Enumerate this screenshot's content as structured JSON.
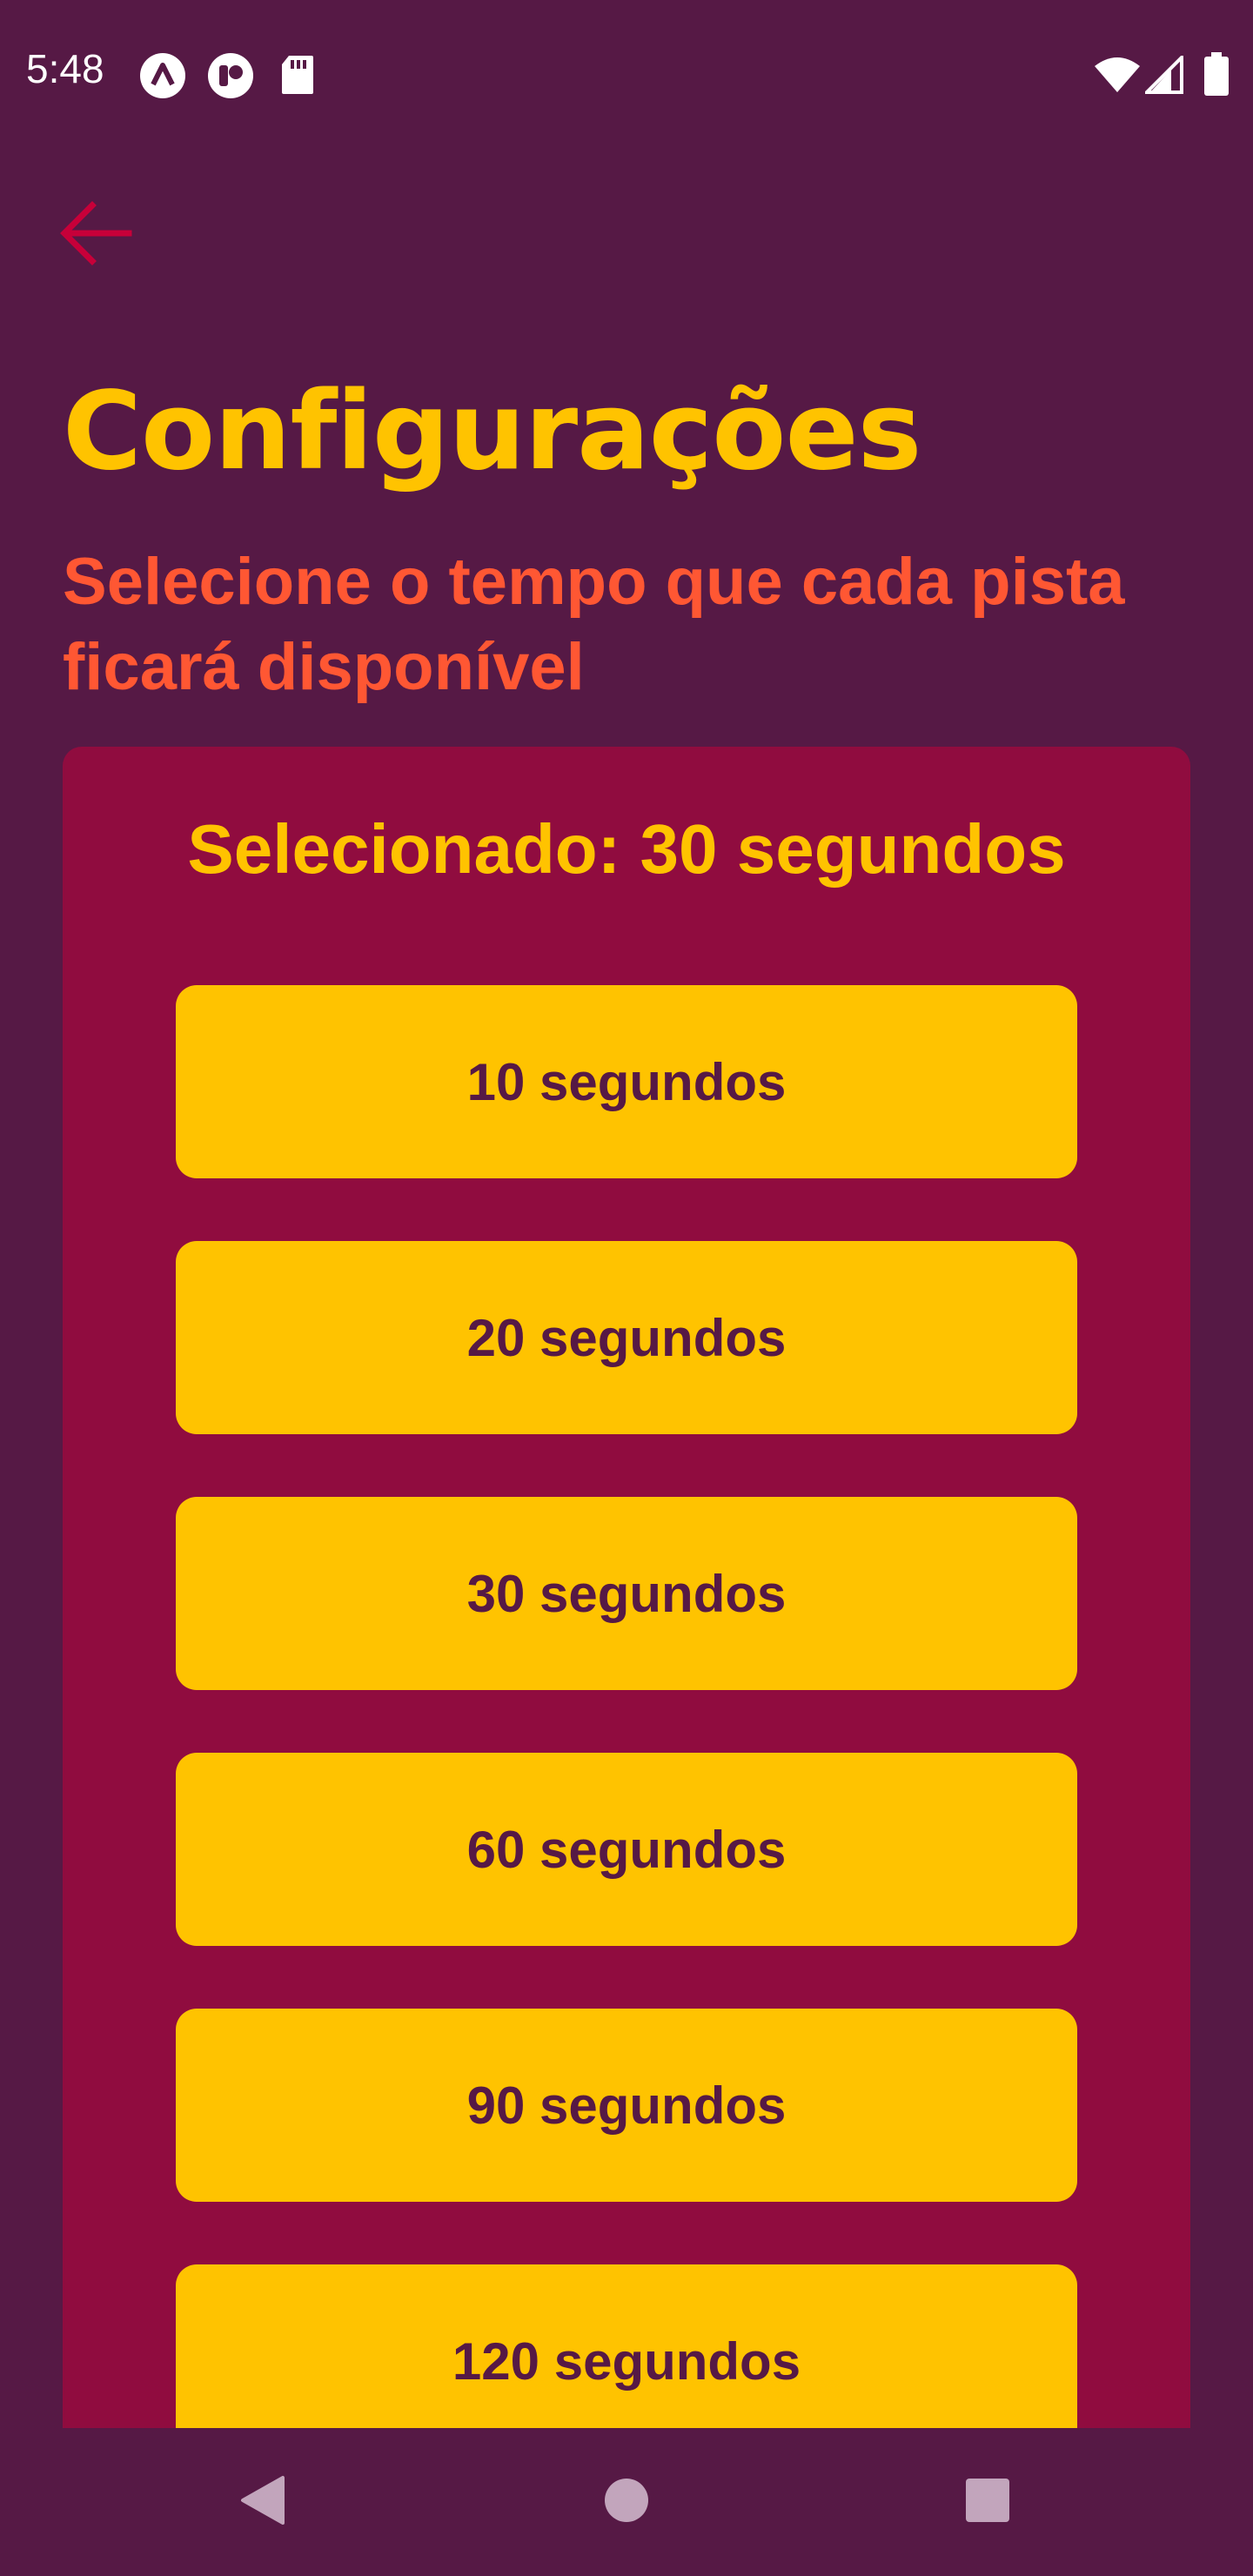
{
  "status_bar": {
    "time": "5:48",
    "left_icons": [
      "a-logo-icon",
      "circle-app-icon",
      "sd-card-icon"
    ],
    "right_icons": [
      "wifi-icon",
      "cell-signal-icon",
      "battery-icon"
    ]
  },
  "header": {
    "back_icon": "arrow-left-icon",
    "title": "Configurações",
    "subtitle": "Selecione o tempo que cada pista ficará disponível"
  },
  "settings": {
    "selected_text": "Selecionado: 30 segundos",
    "options": [
      {
        "label": "10 segundos"
      },
      {
        "label": "20 segundos"
      },
      {
        "label": "30 segundos"
      },
      {
        "label": "60 segundos"
      },
      {
        "label": "90 segundos"
      },
      {
        "label": "120 segundos"
      }
    ]
  },
  "nav_bar": {
    "back": "triangle-back-icon",
    "home": "circle-home-icon",
    "recents": "square-recents-icon"
  },
  "colors": {
    "background": "#561945",
    "card": "#900c3f",
    "accent_yellow": "#ffc300",
    "accent_orange": "#ff5733",
    "back_arrow": "#c70039"
  }
}
